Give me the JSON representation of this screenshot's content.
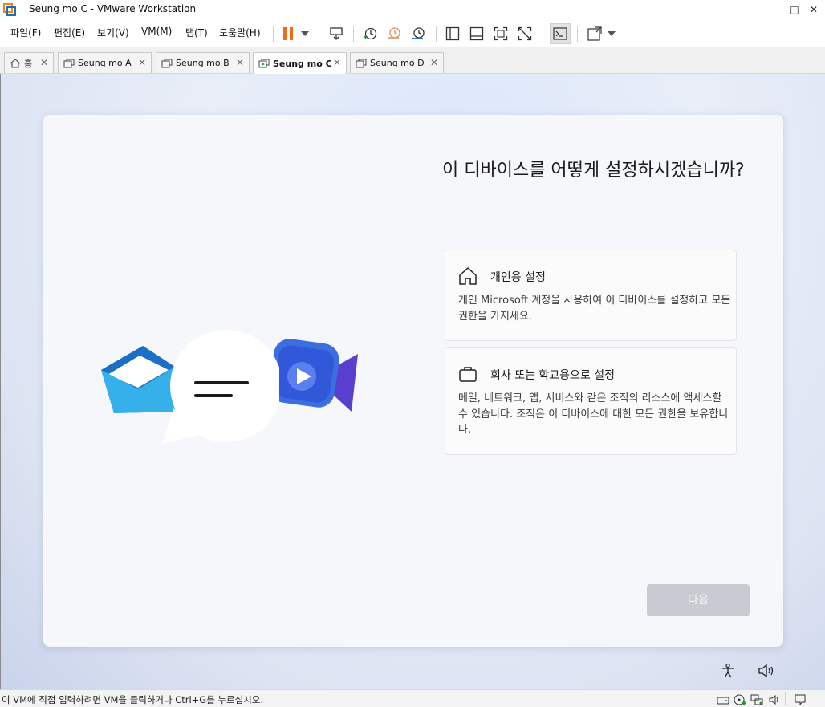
{
  "window": {
    "title": "Seung mo C - VMware Workstation",
    "minimize": "–",
    "maximize": "□",
    "close": "✕"
  },
  "menu": {
    "items": [
      "파일(F)",
      "편집(E)",
      "보기(V)",
      "VM(M)",
      "탭(T)",
      "도움말(H)"
    ]
  },
  "toolbar": {
    "icons": [
      "pause-icon",
      "dropdown-icon",
      "send-ctrl-alt-del-icon",
      "snapshot-icon",
      "revert-snapshot-icon",
      "snapshot-manager-icon",
      "library-icon",
      "thumbnail-icon",
      "full-screen-icon",
      "unity-icon",
      "console-icon",
      "view-stretch-icon",
      "dropdown-icon"
    ],
    "accent": "#f26b1d"
  },
  "tabs": [
    {
      "label": "홈",
      "active": false
    },
    {
      "label": "Seung mo A",
      "active": false
    },
    {
      "label": "Seung mo B",
      "active": false
    },
    {
      "label": "Seung mo C",
      "active": true
    },
    {
      "label": "Seung mo D",
      "active": false
    }
  ],
  "setup": {
    "headline": "이 디바이스를 어떻게 설정하시겠습니까?",
    "options": [
      {
        "icon": "home-icon",
        "title": "개인용 설정",
        "description": "개인 Microsoft 계정을 사용하여 이 디바이스를 설정하고 모든 권한을 가지세요."
      },
      {
        "icon": "briefcase-icon",
        "title": "회사 또는 학교용으로 설정",
        "description": "메일, 네트워크, 앱, 서비스와 같은 조직의 리소스에 액세스할 수 있습니다. 조직은 이 디바이스에 대한 모든 권한을 보유합니다."
      }
    ],
    "next_label": "다음",
    "illustration": [
      "mail-icon",
      "chat-bubble-icon",
      "video-camera-icon"
    ]
  },
  "vm_footer_icons": [
    "accessibility-icon",
    "volume-icon"
  ],
  "status": {
    "text": "이 VM에 직접 입력하려면 VM을 클릭하거나 Ctrl+G를 누르십시오.",
    "icons": [
      "hard-disk-icon",
      "cd-icon",
      "network-icon",
      "sound-icon",
      "message-icon"
    ]
  }
}
